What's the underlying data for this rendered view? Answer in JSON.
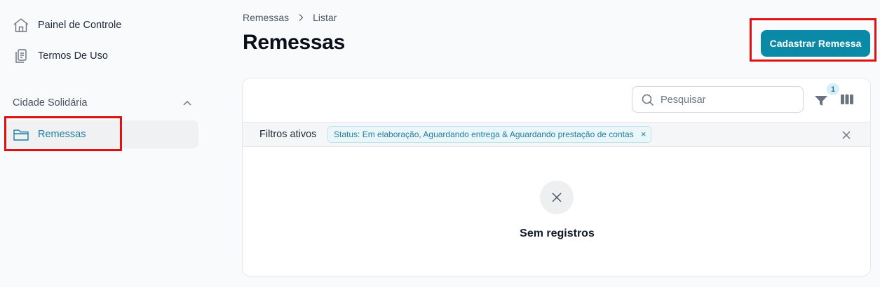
{
  "sidebar": {
    "items": [
      {
        "label": "Painel de Controle",
        "icon": "home-icon"
      },
      {
        "label": "Termos De Uso",
        "icon": "document-icon"
      }
    ],
    "section": {
      "label": "Cidade Solidária",
      "items": [
        {
          "label": "Remessas",
          "icon": "folder-icon",
          "active": true
        }
      ]
    }
  },
  "breadcrumb": {
    "items": [
      "Remessas",
      "Listar"
    ]
  },
  "page": {
    "title": "Remessas"
  },
  "actions": {
    "primary_label": "Cadastrar Remessa"
  },
  "toolbar": {
    "search_placeholder": "Pesquisar",
    "filter_count": "1"
  },
  "filters": {
    "label": "Filtros ativos",
    "chips": [
      "Status: Em elaboração, Aguardando entrega & Aguardando prestação de contas"
    ],
    "chip_remove_glyph": "×"
  },
  "empty_state": {
    "text": "Sem registros"
  },
  "colors": {
    "accent": "#0b8aa8",
    "active_text": "#1b7f9f",
    "annotation": "#e01111"
  }
}
